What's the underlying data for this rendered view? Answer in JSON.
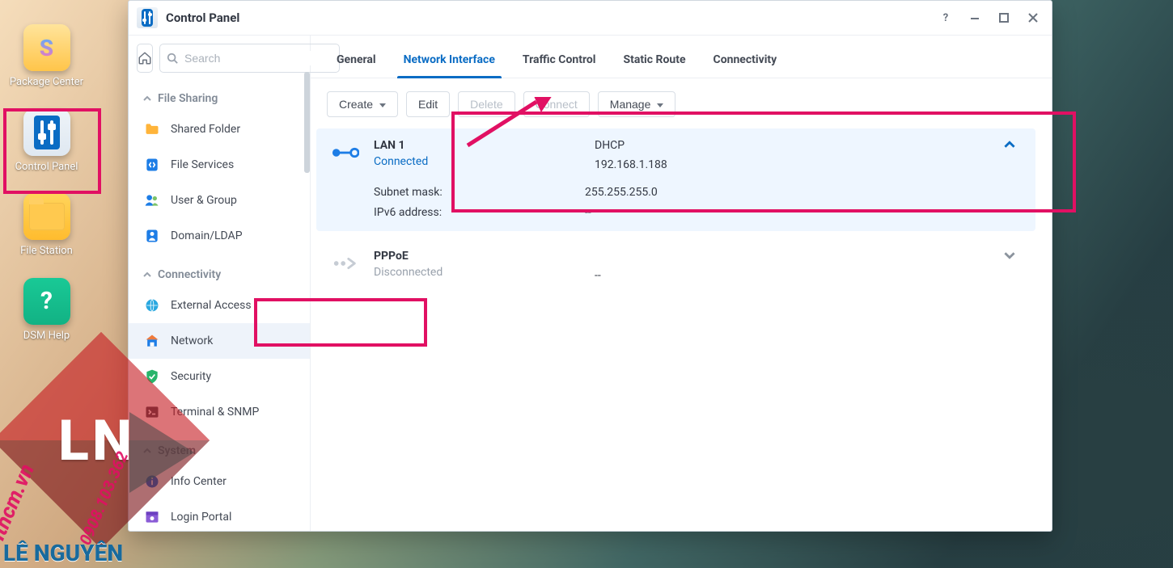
{
  "desktop": {
    "icons": [
      {
        "id": "package-center",
        "label": "Package Center"
      },
      {
        "id": "control-panel",
        "label": "Control Panel"
      },
      {
        "id": "file-station",
        "label": "File Station"
      },
      {
        "id": "dsm-help",
        "label": "DSM Help"
      }
    ]
  },
  "window": {
    "title": "Control Panel"
  },
  "search": {
    "placeholder": "Search"
  },
  "sidebar": {
    "sections": {
      "file_sharing": {
        "title": "File Sharing",
        "items": [
          {
            "id": "shared-folder",
            "label": "Shared Folder"
          },
          {
            "id": "file-services",
            "label": "File Services"
          },
          {
            "id": "user-group",
            "label": "User & Group"
          },
          {
            "id": "domain-ldap",
            "label": "Domain/LDAP"
          }
        ]
      },
      "connectivity": {
        "title": "Connectivity",
        "items": [
          {
            "id": "external-access",
            "label": "External Access"
          },
          {
            "id": "network",
            "label": "Network",
            "active": true
          },
          {
            "id": "security",
            "label": "Security"
          },
          {
            "id": "terminal-snmp",
            "label": "Terminal & SNMP"
          }
        ]
      },
      "system": {
        "title": "System",
        "items": [
          {
            "id": "info-center",
            "label": "Info Center"
          },
          {
            "id": "login-portal",
            "label": "Login Portal"
          }
        ]
      }
    }
  },
  "tabs": [
    {
      "id": "general",
      "label": "General"
    },
    {
      "id": "network-interface",
      "label": "Network Interface",
      "active": true
    },
    {
      "id": "traffic-control",
      "label": "Traffic Control"
    },
    {
      "id": "static-route",
      "label": "Static Route"
    },
    {
      "id": "connectivity",
      "label": "Connectivity"
    }
  ],
  "toolbar": {
    "create": "Create",
    "edit": "Edit",
    "delete": "Delete",
    "connect": "Connect",
    "manage": "Manage"
  },
  "interfaces": {
    "lan1": {
      "name": "LAN 1",
      "status": "Connected",
      "type": "DHCP",
      "ip": "192.168.1.188",
      "details": [
        {
          "k": "Subnet mask:",
          "v": "255.255.255.0"
        },
        {
          "k": "IPv6 address:",
          "v": "--"
        }
      ]
    },
    "pppoe": {
      "name": "PPPoE",
      "status": "Disconnected",
      "value": "--"
    }
  },
  "watermark": {
    "url": "ithcm.vn",
    "phone": "0908.103.362",
    "brand": "LÊ NGUYÊN",
    "logo_text": "LN"
  },
  "annotation": {
    "highlight_color": "#e11063"
  }
}
